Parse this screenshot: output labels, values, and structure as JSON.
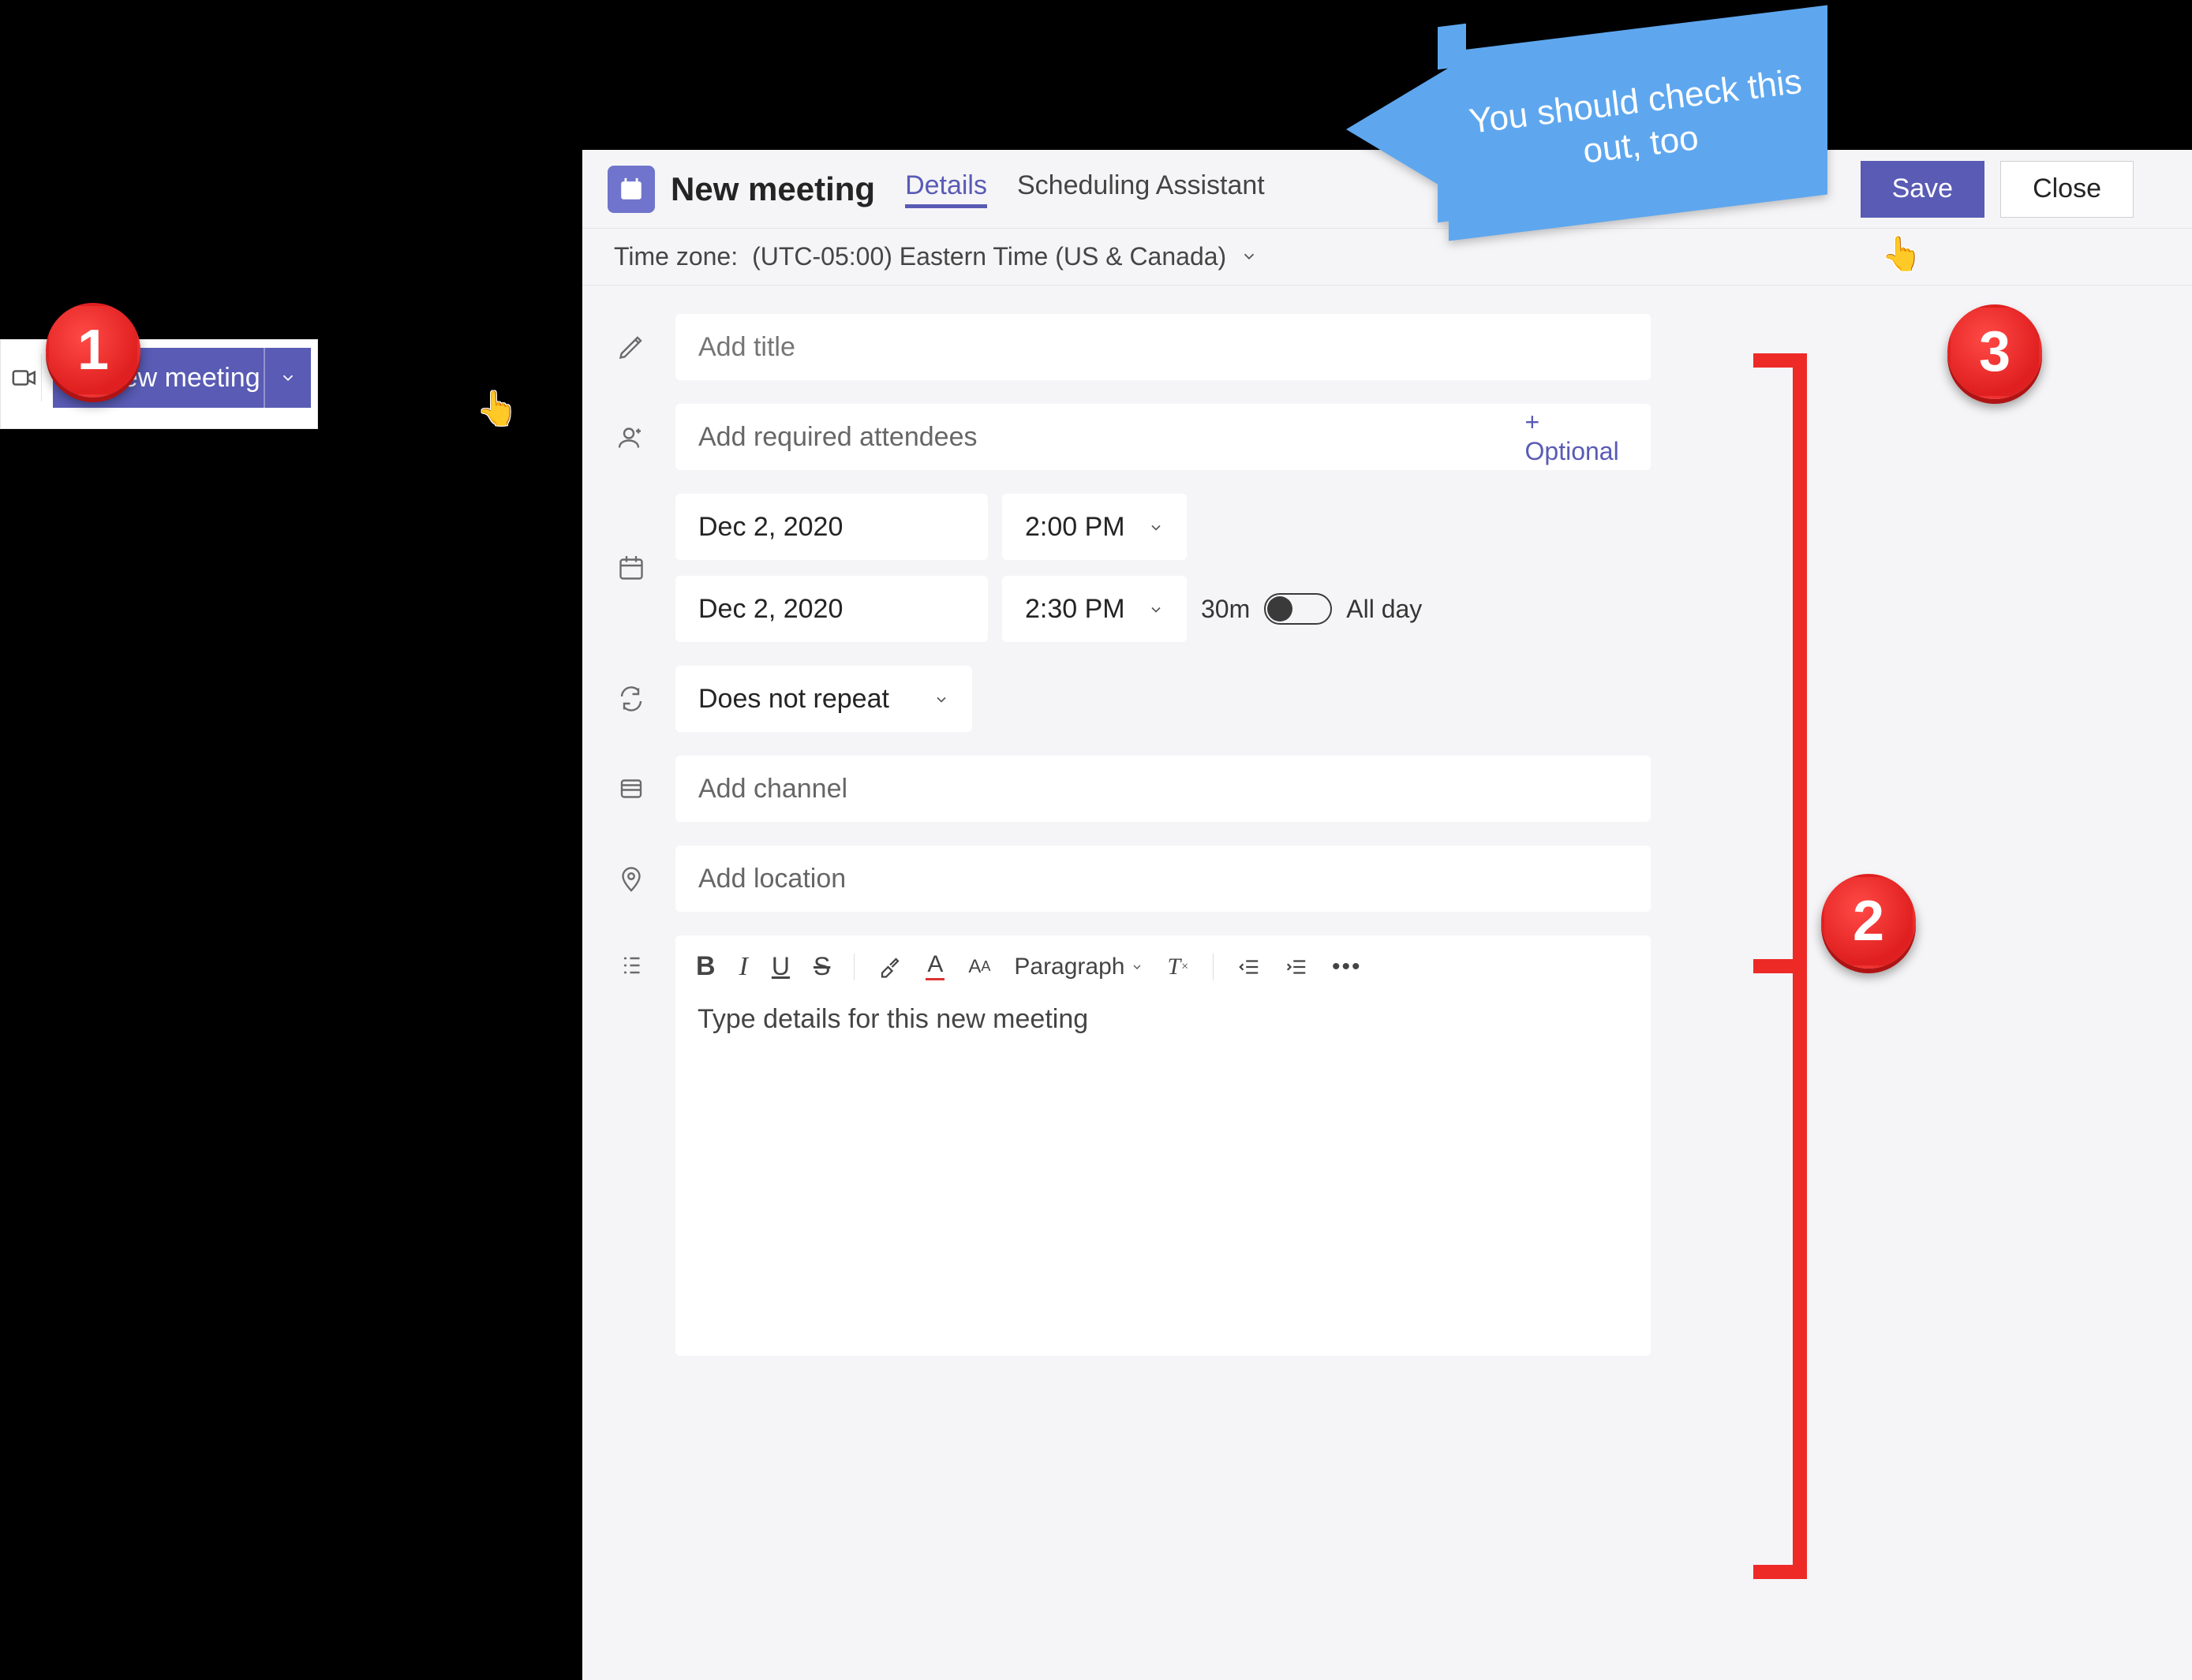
{
  "chip": {
    "label": "New meeting"
  },
  "callout_text": "You should check this out, too",
  "badges": {
    "one": "1",
    "two": "2",
    "three": "3"
  },
  "header": {
    "title": "New meeting",
    "tab_details": "Details",
    "tab_scheduling": "Scheduling Assistant",
    "save_label": "Save",
    "close_label": "Close"
  },
  "timezone": {
    "prefix": "Time zone:",
    "value": "(UTC-05:00) Eastern Time (US & Canada)"
  },
  "form": {
    "title_ph": "Add title",
    "attendees_ph": "Add required attendees",
    "optional_link": "+ Optional",
    "start_date": "Dec 2, 2020",
    "start_time": "2:00 PM",
    "end_date": "Dec 2, 2020",
    "end_time": "2:30 PM",
    "duration": "30m",
    "allday_label": "All day",
    "recurrence": "Does not repeat",
    "channel_ph": "Add channel",
    "location_ph": "Add location",
    "rte_paragraph": "Paragraph",
    "rte_body_ph": "Type details for this new meeting"
  }
}
